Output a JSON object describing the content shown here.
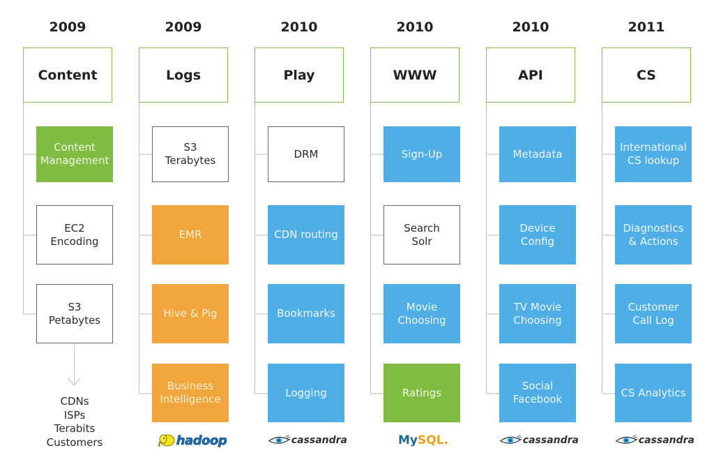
{
  "diagram": {
    "colors": {
      "header_border": "#86c04f",
      "green": "#80bb42",
      "blue": "#4faee6",
      "orange": "#f0a63c",
      "plain_border": "#666666",
      "connector": "#b9bcbf"
    },
    "columns": [
      {
        "year": "2009",
        "title": "Content",
        "items": [
          {
            "label": "Content\nManagement",
            "style": "green"
          },
          {
            "label": "EC2\nEncoding",
            "style": "plain"
          },
          {
            "label": "S3\nPetabytes",
            "style": "plain"
          }
        ],
        "outputs": "CDNs\nISPs\nTerabits\nCustomers",
        "logo": null
      },
      {
        "year": "2009",
        "title": "Logs",
        "items": [
          {
            "label": "S3\nTerabytes",
            "style": "plain"
          },
          {
            "label": "EMR",
            "style": "orange"
          },
          {
            "label": "Hive & Pig",
            "style": "orange"
          },
          {
            "label": "Business\nIntelligence",
            "style": "orange"
          }
        ],
        "logo": {
          "name": "hadoop",
          "text": "hadoop"
        }
      },
      {
        "year": "2010",
        "title": "Play",
        "items": [
          {
            "label": "DRM",
            "style": "plain"
          },
          {
            "label": "CDN routing",
            "style": "blue"
          },
          {
            "label": "Bookmarks",
            "style": "blue"
          },
          {
            "label": "Logging",
            "style": "blue"
          }
        ],
        "logo": {
          "name": "cassandra",
          "text": "cassandra"
        }
      },
      {
        "year": "2010",
        "title": "WWW",
        "items": [
          {
            "label": "Sign-Up",
            "style": "blue"
          },
          {
            "label": "Search\nSolr",
            "style": "plain"
          },
          {
            "label": "Movie\nChoosing",
            "style": "blue"
          },
          {
            "label": "Ratings",
            "style": "green"
          }
        ],
        "logo": {
          "name": "mysql",
          "text_my": "My",
          "text_sql": "SQL",
          "dot": "."
        }
      },
      {
        "year": "2010",
        "title": "API",
        "items": [
          {
            "label": "Metadata",
            "style": "blue"
          },
          {
            "label": "Device\nConfig",
            "style": "blue"
          },
          {
            "label": "TV Movie\nChoosing",
            "style": "blue"
          },
          {
            "label": "Social\nFacebook",
            "style": "blue"
          }
        ],
        "logo": {
          "name": "cassandra",
          "text": "cassandra"
        }
      },
      {
        "year": "2011",
        "title": "CS",
        "items": [
          {
            "label": "International\nCS lookup",
            "style": "blue"
          },
          {
            "label": "Diagnostics\n& Actions",
            "style": "blue"
          },
          {
            "label": "Customer\nCall Log",
            "style": "blue"
          },
          {
            "label": "CS Analytics",
            "style": "blue"
          }
        ],
        "logo": {
          "name": "cassandra",
          "text": "cassandra"
        }
      }
    ]
  }
}
